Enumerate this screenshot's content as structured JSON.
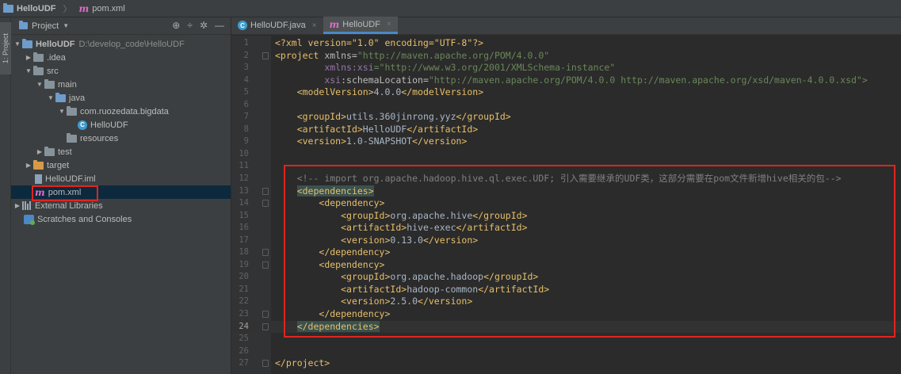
{
  "breadcrumb": {
    "project": "HelloUDF",
    "file": "pom.xml"
  },
  "toolstrip": {
    "project_tab": "1: Project"
  },
  "project_panel": {
    "title": "Project",
    "tree": [
      {
        "label": "HelloUDF",
        "path": "D:\\develop_code\\HelloUDF"
      },
      {
        "label": ".idea"
      },
      {
        "label": "src"
      },
      {
        "label": "main"
      },
      {
        "label": "java"
      },
      {
        "label": "com.ruozedata.bigdata"
      },
      {
        "label": "HelloUDF"
      },
      {
        "label": "resources"
      },
      {
        "label": "test"
      },
      {
        "label": "target"
      },
      {
        "label": "HelloUDF.iml"
      },
      {
        "label": "pom.xml"
      },
      {
        "label": "External Libraries"
      },
      {
        "label": "Scratches and Consoles"
      }
    ]
  },
  "tabs": [
    {
      "label": "HelloUDF.java"
    },
    {
      "label": "HelloUDF"
    }
  ],
  "editor": {
    "line_numbers": [
      "1",
      "2",
      "3",
      "4",
      "5",
      "6",
      "7",
      "8",
      "9",
      "10",
      "11",
      "12",
      "13",
      "14",
      "15",
      "16",
      "17",
      "18",
      "19",
      "20",
      "21",
      "22",
      "23",
      "24",
      "25",
      "26",
      "27"
    ],
    "code": {
      "l1": "<?xml version=\"1.0\" encoding=\"UTF-8\"?>",
      "l2_tag": "<project ",
      "l2_attr": "xmlns=",
      "l2_val": "\"http://maven.apache.org/POM/4.0.0\"",
      "l3_ns": "xmlns:xsi",
      "l3_val": "=\"http://www.w3.org/2001/XMLSchema-instance\"",
      "l4_ns": "xsi",
      "l4_attr": ":schemaLocation=",
      "l4_val": "\"http://maven.apache.org/POM/4.0.0 http://maven.apache.org/xsd/maven-4.0.0.xsd\">",
      "l5_open": "<modelVersion>",
      "l5_text": "4.0.0",
      "l5_close": "</modelVersion>",
      "l7_open": "<groupId>",
      "l7_text": "utils.360jinrong.yyz",
      "l7_close": "</groupId>",
      "l8_open": "<artifactId>",
      "l8_text": "HelloUDF",
      "l8_close": "</artifactId>",
      "l9_open": "<version>",
      "l9_text": "1.0-SNAPSHOT",
      "l9_close": "</version>",
      "l12": "<!-- import org.apache.hadoop.hive.ql.exec.UDF; 引入需要继承的UDF类，这部分需要在pom文件新增hive相关的包-->",
      "l13": "<dependencies>",
      "l14": "<dependency>",
      "l15_open": "<groupId>",
      "l15_text": "org.apache.hive",
      "l15_close": "</groupId>",
      "l16_open": "<artifactId>",
      "l16_text": "hive-exec",
      "l16_close": "</artifactId>",
      "l17_open": "<version>",
      "l17_text": "0.13.0",
      "l17_close": "</version>",
      "l18": "</dependency>",
      "l19": "<dependency>",
      "l20_open": "<groupId>",
      "l20_text": "org.apache.hadoop",
      "l20_close": "</groupId>",
      "l21_open": "<artifactId>",
      "l21_text": "hadoop-common",
      "l21_close": "</artifactId>",
      "l22_open": "<version>",
      "l22_text": "2.5.0",
      "l22_close": "</version>",
      "l23": "</dependency>",
      "l24": "</dependencies>",
      "l27": "</project>"
    }
  },
  "colors": {
    "annotation_red": "#e0251f",
    "active_tab": "#4a88c7",
    "xml_tag": "#e8bf6a",
    "xml_value": "#6a8759"
  }
}
